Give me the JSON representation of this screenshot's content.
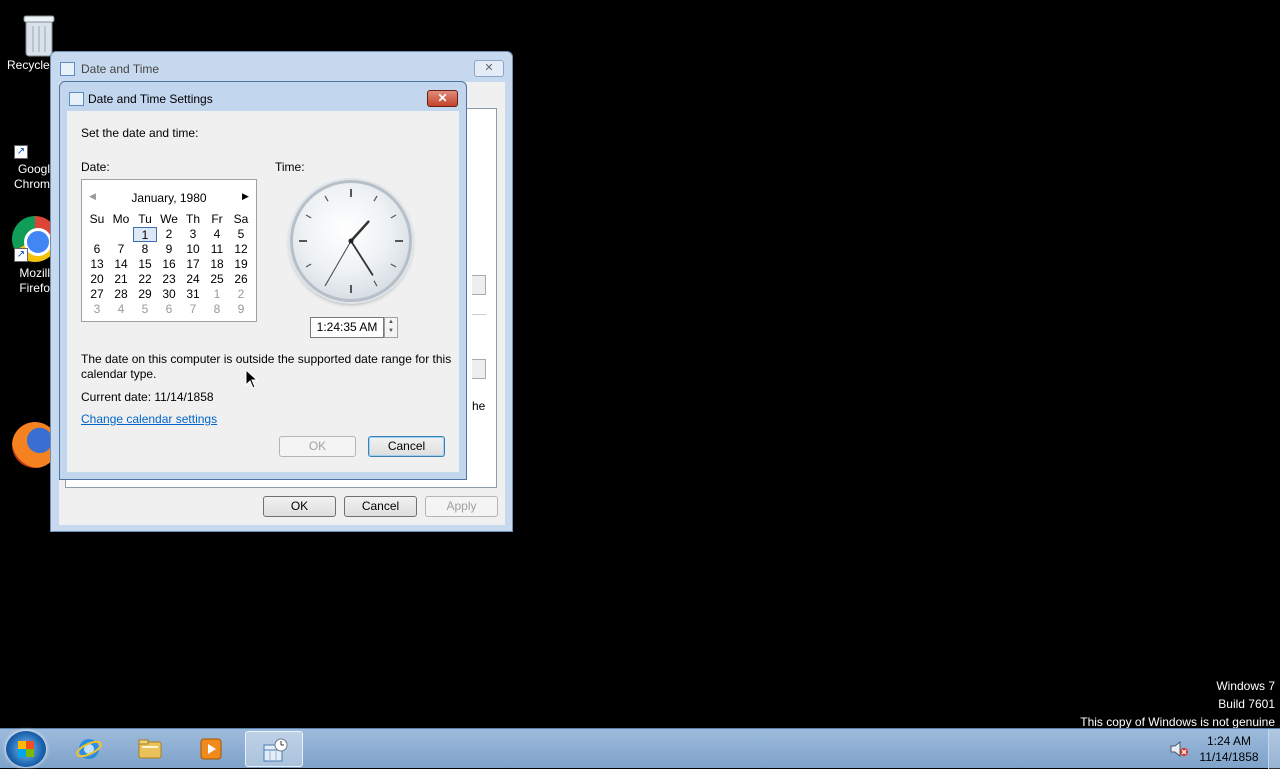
{
  "desktop": {
    "icons": [
      {
        "label": "Recycle"
      },
      {
        "label": "Googl\nChrom"
      },
      {
        "label": "Mozill\nFirefo"
      }
    ],
    "watermark": {
      "line1": "Windows 7",
      "line2": "Build 7601",
      "line3": "This copy of Windows is not genuine"
    }
  },
  "back_window": {
    "title": "Date and Time",
    "close_label": "✕",
    "partial_text": "he",
    "buttons": {
      "ok": "OK",
      "cancel": "Cancel",
      "apply": "Apply"
    }
  },
  "dialog": {
    "title": "Date and Time Settings",
    "close_label": "✕",
    "instruction": "Set the date and time:",
    "date_label": "Date:",
    "time_label": "Time:",
    "calendar": {
      "month_year": "January, 1980",
      "prev_label": "◀",
      "next_label": "▶",
      "weekdays": [
        "Su",
        "Mo",
        "Tu",
        "We",
        "Th",
        "Fr",
        "Sa"
      ],
      "days": [
        "",
        "",
        "1",
        "2",
        "3",
        "4",
        "5",
        "6",
        "7",
        "8",
        "9",
        "10",
        "11",
        "12",
        "13",
        "14",
        "15",
        "16",
        "17",
        "18",
        "19",
        "20",
        "21",
        "22",
        "23",
        "24",
        "25",
        "26",
        "27",
        "28",
        "29",
        "30",
        "31",
        "1",
        "2",
        "3",
        "4",
        "5",
        "6",
        "7",
        "8",
        "9"
      ],
      "selected_day": "1"
    },
    "time_value": "1:24:35 AM",
    "clock": {
      "hour": 1,
      "minute": 24,
      "second": 35
    },
    "warning": "The date on this computer is outside the supported date range for this calendar type.",
    "current_date": "Current date: 11/14/1858",
    "change_calendar_link": "Change calendar settings",
    "ok_label": "OK",
    "cancel_label": "Cancel"
  },
  "taskbar": {
    "clock_time": "1:24 AM",
    "clock_date": "11/14/1858",
    "icons": [
      "start-orb-icon",
      "internet-explorer-icon",
      "file-explorer-icon",
      "media-player-icon",
      "date-time-icon"
    ]
  }
}
